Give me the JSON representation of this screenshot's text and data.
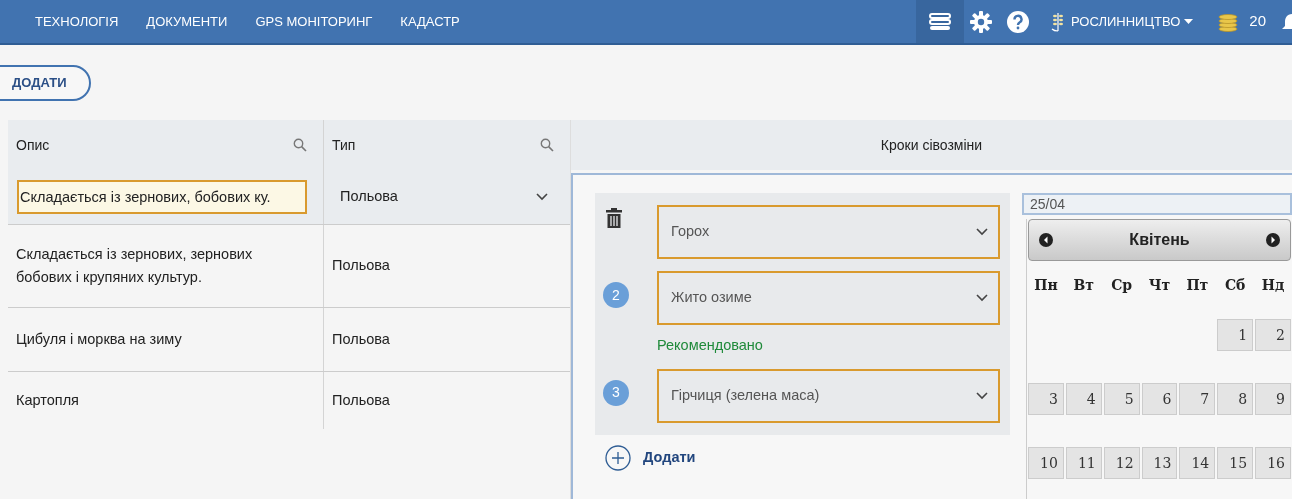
{
  "nav": {
    "items": [
      "ТЕХНОЛОГІЯ",
      "ДОКУМЕНТИ",
      "GPS МОНІТОРИНГ",
      "КАДАСТР"
    ],
    "module": "РОСЛИННИЦТВО",
    "coins": "20"
  },
  "add_button": "ДОДАТИ",
  "table": {
    "columns": [
      "Опис",
      "Тип"
    ],
    "filter": {
      "description": "Складається із зернових, бобових ку.",
      "type": "Польова"
    },
    "rows": [
      {
        "description": "Складається із зернових, зернових бобових і крупяних культур.",
        "type": "Польова"
      },
      {
        "description": "Цибуля і морква на зиму",
        "type": "Польова"
      },
      {
        "description": "Картопля",
        "type": "Польова"
      }
    ]
  },
  "steps_panel": {
    "title": "Кроки сівозміни",
    "steps": [
      {
        "kind": "delete",
        "crop": "Горох"
      },
      {
        "kind": "numbered",
        "number": "2",
        "crop": "Жито озиме",
        "note": "Рекомендовано"
      },
      {
        "kind": "numbered",
        "number": "3",
        "crop": "Гірчиця (зелена маса)"
      }
    ],
    "add_link": "Додати",
    "date_field": "25/04",
    "calendar": {
      "month": "Квітень",
      "weekdays": [
        "Пн",
        "Вт",
        "Ср",
        "Чт",
        "Пт",
        "Сб",
        "Нд"
      ],
      "weeks": [
        {
          "kind": "first",
          "days": [
            "1",
            "2"
          ]
        },
        {
          "kind": "full",
          "days": [
            "3",
            "4",
            "5",
            "6",
            "7",
            "8",
            "9"
          ]
        },
        {
          "kind": "full",
          "days": [
            "10",
            "11",
            "12",
            "13",
            "14",
            "15",
            "16"
          ]
        }
      ]
    }
  }
}
